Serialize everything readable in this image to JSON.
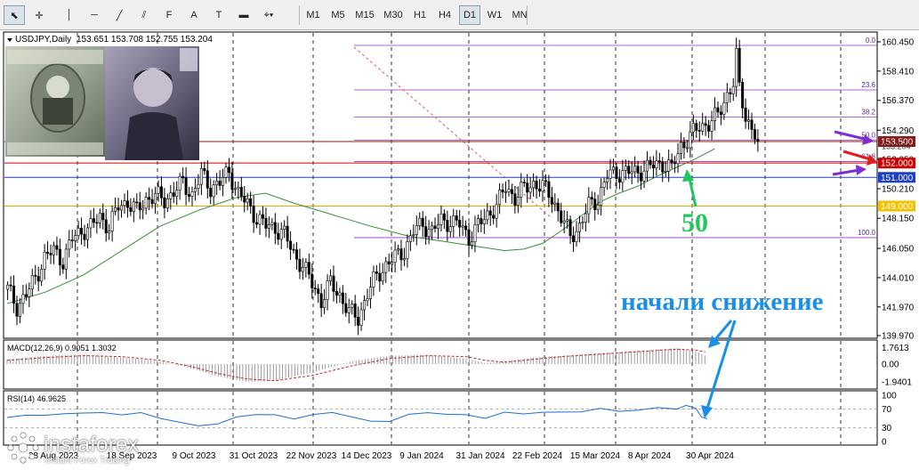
{
  "toolbar": {
    "tools": [
      {
        "name": "cursor",
        "glyph": "⬉",
        "active": true
      },
      {
        "name": "crosshair",
        "glyph": "✛",
        "active": false
      },
      {
        "name": "vertical-line",
        "glyph": "│",
        "active": false
      },
      {
        "name": "horizontal-line",
        "glyph": "─",
        "active": false
      },
      {
        "name": "trendline",
        "glyph": "╱",
        "active": false
      },
      {
        "name": "fibo-fan",
        "glyph": "⫽",
        "active": false
      },
      {
        "name": "fibo-retracement",
        "glyph": "F",
        "active": false
      },
      {
        "name": "text",
        "glyph": "A",
        "active": false
      },
      {
        "name": "text-label",
        "glyph": "T",
        "active": false
      },
      {
        "name": "rectangle",
        "glyph": "▬",
        "active": false
      },
      {
        "name": "shapes-dropdown",
        "glyph": "⌖▾",
        "active": false
      }
    ],
    "timeframes": [
      "M1",
      "M5",
      "M15",
      "M30",
      "H1",
      "H4",
      "D1",
      "W1",
      "MN"
    ],
    "active_timeframe": "D1"
  },
  "header": {
    "symbol": "USDJPY,Daily",
    "ohlc": "153.651 153.708 152.755 153.204"
  },
  "chart_data": {
    "type": "candlestick",
    "symbol": "USDJPY",
    "timeframe": "Daily",
    "ylim": [
      139.97,
      161.4
    ],
    "y_ticks": [
      "160.450",
      "158.410",
      "156.370",
      "154.290",
      "152.250",
      "150.210",
      "148.150",
      "146.050",
      "144.010",
      "141.970",
      "139.970"
    ],
    "x_ticks": [
      "28 Aug 2023",
      "18 Sep 2023",
      "9 Oct 2023",
      "31 Oct 2023",
      "22 Nov 2023",
      "14 Dec 2023",
      "9 Jan 2024",
      "31 Jan 2024",
      "22 Feb 2024",
      "15 Mar 2024",
      "8 Apr 2024",
      "30 Apr 2024"
    ],
    "close_path": [
      [
        0,
        143.2
      ],
      [
        3,
        142.0
      ],
      [
        6,
        142.8
      ],
      [
        9,
        144.0
      ],
      [
        12,
        145.4
      ],
      [
        15,
        145.9
      ],
      [
        18,
        145.2
      ],
      [
        21,
        146.7
      ],
      [
        24,
        147.3
      ],
      [
        27,
        147.5
      ],
      [
        30,
        148.3
      ],
      [
        33,
        147.5
      ],
      [
        36,
        149.0
      ],
      [
        39,
        149.3
      ],
      [
        42,
        148.6
      ],
      [
        45,
        149.5
      ],
      [
        48,
        149.7
      ],
      [
        51,
        149.4
      ],
      [
        54,
        150.0
      ],
      [
        57,
        150.6
      ],
      [
        60,
        149.8
      ],
      [
        63,
        151.2
      ],
      [
        66,
        150.3
      ],
      [
        69,
        150.6
      ],
      [
        72,
        151.4
      ],
      [
        75,
        149.9
      ],
      [
        78,
        149.1
      ],
      [
        81,
        148.2
      ],
      [
        84,
        147.6
      ],
      [
        87,
        147.5
      ],
      [
        90,
        147.0
      ],
      [
        93,
        145.7
      ],
      [
        96,
        144.8
      ],
      [
        99,
        143.6
      ],
      [
        102,
        142.4
      ],
      [
        105,
        143.6
      ],
      [
        108,
        142.8
      ],
      [
        111,
        141.6
      ],
      [
        114,
        141.2
      ],
      [
        117,
        142.9
      ],
      [
        120,
        144.1
      ],
      [
        123,
        144.9
      ],
      [
        126,
        145.4
      ],
      [
        129,
        145.9
      ],
      [
        132,
        147.2
      ],
      [
        135,
        147.8
      ],
      [
        138,
        147.2
      ],
      [
        141,
        148.0
      ],
      [
        144,
        147.9
      ],
      [
        147,
        147.7
      ],
      [
        150,
        146.8
      ],
      [
        153,
        147.6
      ],
      [
        156,
        148.4
      ],
      [
        159,
        149.0
      ],
      [
        162,
        150.3
      ],
      [
        165,
        149.6
      ],
      [
        168,
        150.2
      ],
      [
        171,
        150.6
      ],
      [
        174,
        150.3
      ],
      [
        177,
        149.6
      ],
      [
        180,
        148.2
      ],
      [
        183,
        146.9
      ],
      [
        186,
        147.6
      ],
      [
        189,
        149.0
      ],
      [
        192,
        149.5
      ],
      [
        195,
        151.1
      ],
      [
        198,
        151.3
      ],
      [
        201,
        151.4
      ],
      [
        204,
        151.3
      ],
      [
        207,
        151.6
      ],
      [
        210,
        151.8
      ],
      [
        213,
        152.0
      ],
      [
        216,
        151.6
      ],
      [
        219,
        153.2
      ],
      [
        222,
        153.9
      ],
      [
        225,
        154.5
      ],
      [
        228,
        154.8
      ],
      [
        231,
        155.3
      ],
      [
        234,
        156.8
      ],
      [
        237,
        158.0
      ],
      [
        240,
        155.3
      ],
      [
        243,
        154.0
      ],
      [
        244,
        153.2
      ]
    ],
    "sma_path": [
      [
        0,
        142.2
      ],
      [
        20,
        143.0
      ],
      [
        40,
        144.2
      ],
      [
        60,
        145.9
      ],
      [
        80,
        147.6
      ],
      [
        100,
        148.7
      ],
      [
        120,
        149.6
      ],
      [
        135,
        149.9
      ],
      [
        150,
        149.2
      ],
      [
        170,
        148.4
      ],
      [
        190,
        147.6
      ],
      [
        210,
        146.9
      ],
      [
        230,
        146.5
      ],
      [
        245,
        146.2
      ],
      [
        260,
        145.9
      ],
      [
        270,
        146.0
      ],
      [
        280,
        146.4
      ],
      [
        290,
        147.3
      ],
      [
        300,
        148.3
      ],
      [
        310,
        149.3
      ],
      [
        320,
        149.9
      ],
      [
        330,
        150.4
      ],
      [
        340,
        151.1
      ],
      [
        350,
        151.7
      ],
      [
        360,
        152.3
      ],
      [
        370,
        153.0
      ]
    ],
    "fibonacci": [
      {
        "level": "0.0",
        "price": 160.2
      },
      {
        "level": "23.6",
        "price": 157.1
      },
      {
        "level": "38.2",
        "price": 155.2
      },
      {
        "level": "50.0",
        "price": 153.6
      },
      {
        "level": "61.8",
        "price": 152.1
      },
      {
        "level": "100.0",
        "price": 146.8
      }
    ],
    "horizontal_levels": [
      {
        "price": 153.5,
        "label": "153.500",
        "color": "#8b1a1a"
      },
      {
        "price": 152.0,
        "label": "152.000",
        "color": "#d40000"
      },
      {
        "price": 151.0,
        "label": "151.000",
        "color": "#1c3ec8"
      },
      {
        "price": 149.0,
        "label": "149.000",
        "color": "#e0b000"
      }
    ],
    "current_price": {
      "price": 153.204,
      "label": "153.204"
    },
    "annotations": [
      {
        "text": "50",
        "color": "#22c55e"
      },
      {
        "text": "начали снижение",
        "color": "#1a8fe6"
      }
    ],
    "macd": {
      "label": "MACD(12,26,9) 0.9051 1.3032",
      "ylim": [
        -2.3,
        2.2
      ],
      "ticks": [
        "1.7613",
        "0.00",
        "-1.9401"
      ],
      "histogram_path": [
        [
          0,
          0.5
        ],
        [
          20,
          0.9
        ],
        [
          40,
          1.0
        ],
        [
          60,
          0.7
        ],
        [
          80,
          0.3
        ],
        [
          95,
          -0.4
        ],
        [
          110,
          -1.3
        ],
        [
          125,
          -1.9
        ],
        [
          140,
          -1.8
        ],
        [
          160,
          -0.9
        ],
        [
          180,
          0.3
        ],
        [
          200,
          0.9
        ],
        [
          220,
          1.0
        ],
        [
          240,
          0.6
        ],
        [
          250,
          0.1
        ],
        [
          260,
          0.3
        ],
        [
          275,
          0.7
        ],
        [
          290,
          0.9
        ],
        [
          305,
          1.1
        ],
        [
          320,
          1.3
        ],
        [
          335,
          1.5
        ],
        [
          350,
          1.7
        ],
        [
          360,
          1.4
        ],
        [
          365,
          0.9
        ]
      ],
      "signal_path": [
        [
          0,
          0.4
        ],
        [
          20,
          0.7
        ],
        [
          40,
          0.9
        ],
        [
          60,
          0.8
        ],
        [
          80,
          0.4
        ],
        [
          95,
          -0.2
        ],
        [
          110,
          -1.0
        ],
        [
          125,
          -1.6
        ],
        [
          140,
          -1.8
        ],
        [
          160,
          -1.2
        ],
        [
          180,
          -0.2
        ],
        [
          200,
          0.6
        ],
        [
          220,
          0.9
        ],
        [
          240,
          0.8
        ],
        [
          250,
          0.4
        ],
        [
          260,
          0.2
        ],
        [
          275,
          0.5
        ],
        [
          290,
          0.8
        ],
        [
          305,
          1.0
        ],
        [
          320,
          1.2
        ],
        [
          335,
          1.4
        ],
        [
          350,
          1.6
        ],
        [
          360,
          1.5
        ],
        [
          365,
          1.3
        ]
      ]
    },
    "rsi": {
      "label": "RSI(14) 46.9625",
      "ylim": [
        0,
        100
      ],
      "ticks": [
        "100",
        "70",
        "30",
        "0"
      ],
      "levels": [
        70,
        30
      ],
      "path": [
        [
          0,
          52
        ],
        [
          10,
          58
        ],
        [
          20,
          55
        ],
        [
          30,
          62
        ],
        [
          40,
          60
        ],
        [
          50,
          63
        ],
        [
          60,
          58
        ],
        [
          70,
          61
        ],
        [
          80,
          52
        ],
        [
          90,
          40
        ],
        [
          100,
          35
        ],
        [
          110,
          38
        ],
        [
          120,
          52
        ],
        [
          130,
          60
        ],
        [
          140,
          56
        ],
        [
          150,
          50
        ],
        [
          160,
          58
        ],
        [
          170,
          62
        ],
        [
          180,
          55
        ],
        [
          190,
          42
        ],
        [
          200,
          45
        ],
        [
          210,
          58
        ],
        [
          220,
          62
        ],
        [
          230,
          60
        ],
        [
          240,
          56
        ],
        [
          250,
          52
        ],
        [
          260,
          62
        ],
        [
          270,
          60
        ],
        [
          280,
          64
        ],
        [
          290,
          62
        ],
        [
          300,
          66
        ],
        [
          310,
          70
        ],
        [
          320,
          66
        ],
        [
          330,
          68
        ],
        [
          340,
          72
        ],
        [
          350,
          72
        ],
        [
          355,
          78
        ],
        [
          360,
          70
        ],
        [
          363,
          55
        ],
        [
          366,
          47
        ]
      ]
    }
  },
  "watermark": {
    "brand": "instaforex",
    "tagline": "Instant Forex Trading"
  }
}
